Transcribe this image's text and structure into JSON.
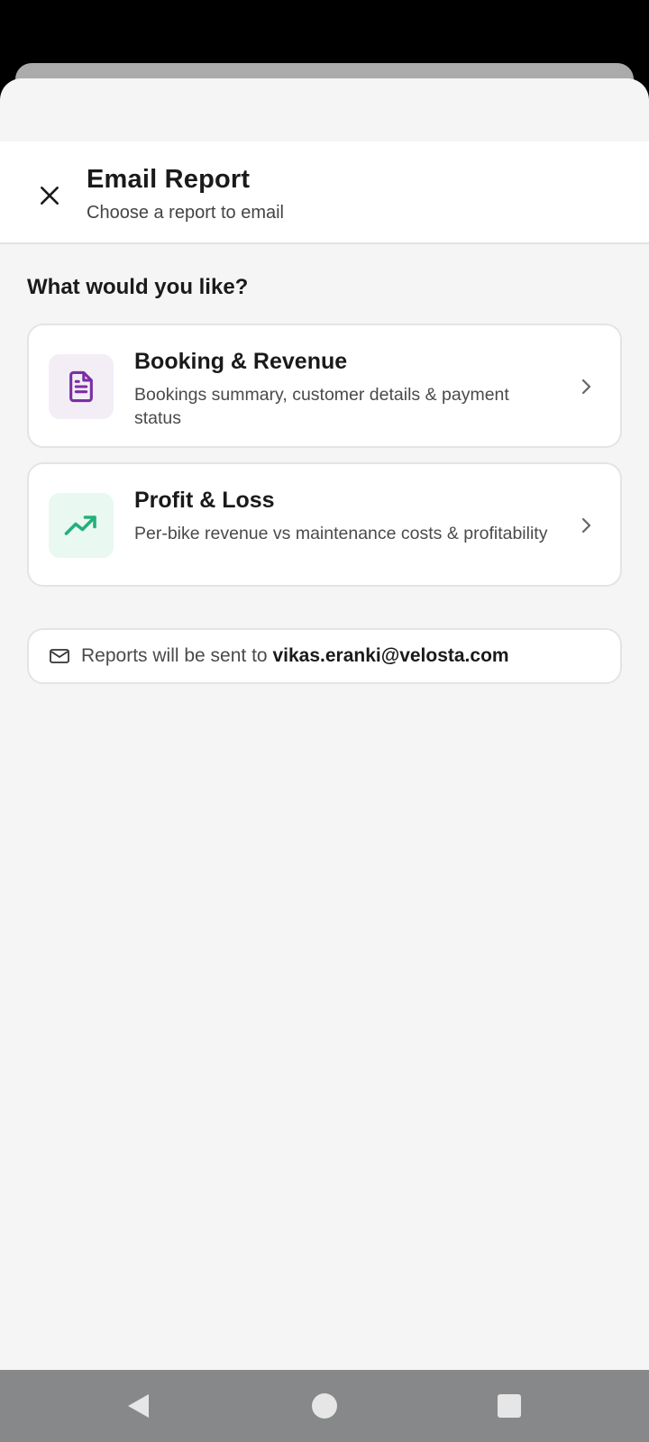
{
  "header": {
    "title": "Email Report",
    "subtitle": "Choose a report to email"
  },
  "section": {
    "title": "What would you like?"
  },
  "reports": [
    {
      "title": "Booking & Revenue",
      "description": "Bookings summary, customer details & payment status",
      "icon": "document-icon",
      "icon_color": "#7b2fa3",
      "icon_bg": "#f3eef6"
    },
    {
      "title": "Profit & Loss",
      "description": "Per-bike revenue vs maintenance costs & profitability",
      "icon": "trending-up-icon",
      "icon_color": "#22b07d",
      "icon_bg": "#e9f8f1"
    }
  ],
  "info": {
    "prefix": "Reports will be sent to",
    "email": "vikas.eranki@velosta.com",
    "icon": "mail-icon"
  },
  "navbar": {
    "icons": [
      "back-icon",
      "home-icon",
      "recents-icon"
    ]
  }
}
